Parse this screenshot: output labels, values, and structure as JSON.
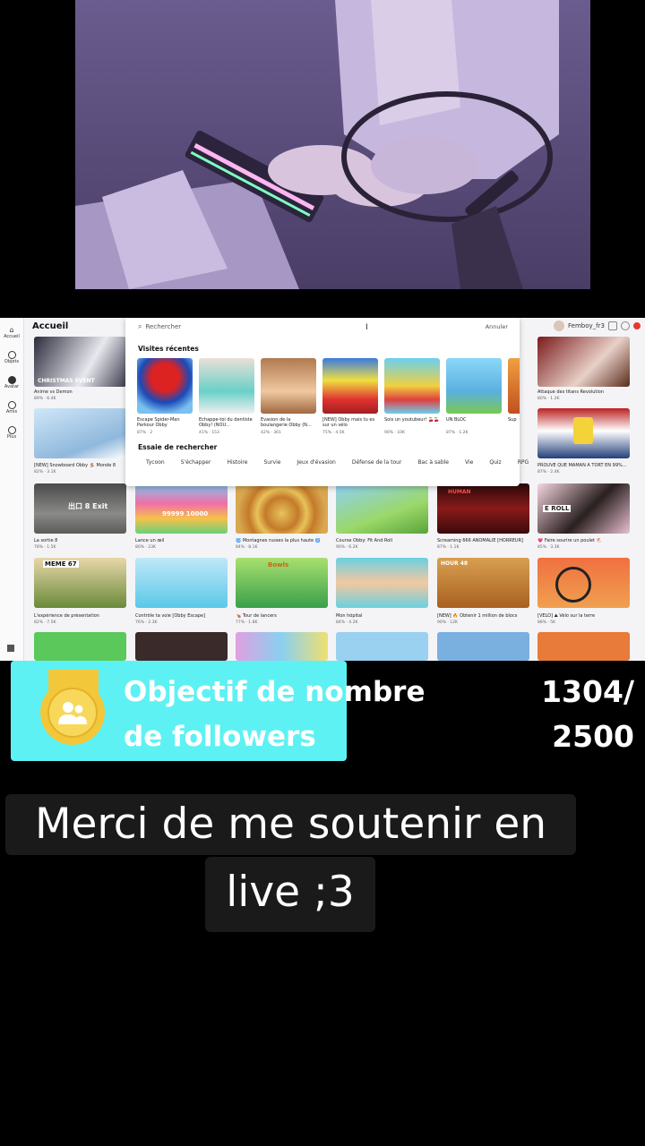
{
  "screen": {
    "title": "Accueil",
    "user_name": "Femboy_fr3",
    "sidebar": [
      {
        "label": "Accueil",
        "icon": "home-icon"
      },
      {
        "label": "Objets",
        "icon": "bag-icon"
      },
      {
        "label": "Avatar",
        "icon": "avatar-icon"
      },
      {
        "label": "Amis",
        "icon": "friends-icon"
      },
      {
        "label": "Plus",
        "icon": "more-icon"
      }
    ],
    "search": {
      "placeholder": "Rechercher",
      "cursor": "I",
      "cancel": "Annuler",
      "recent_title": "Visites récentes",
      "recent": [
        {
          "title": "Escape Spider-Man Parkour Obby",
          "rating": "87%",
          "players": "2"
        },
        {
          "title": "Echappe-toi du dentiste Obby! (NOU...",
          "rating": "41%",
          "players": "153"
        },
        {
          "title": "Évasion de la boulangerie Obby (N...",
          "rating": "42%",
          "players": "301"
        },
        {
          "title": "[NEW] Obby mais tu es sur un vélo",
          "rating": "75%",
          "players": "4.5K"
        },
        {
          "title": "Sois un youtubeur! 🍒🍒",
          "rating": "90%",
          "players": "10K"
        },
        {
          "title": "UN BLOC",
          "rating": "87%",
          "players": "1.2K"
        },
        {
          "title": "Sup",
          "rating": "",
          "players": ""
        }
      ],
      "suggest_title": "Essaie de rechercher",
      "chips": [
        "Tycoon",
        "S'échapper",
        "Histoire",
        "Survie",
        "Jeux d'évasion",
        "Défense de la tour",
        "Bac à sable",
        "Vie",
        "Quiz",
        "RPG"
      ]
    },
    "tiles": [
      {
        "title": "Anime vs Demon",
        "rating": "89% · 6.4K"
      },
      {
        "title": "Attaque des titans Revolution",
        "rating": "80% · 1.2K"
      },
      {
        "title": "[NEW] Snowboard Obby 🏂 Monde 8",
        "rating": "82% · 3.1K"
      },
      {
        "title": "PROUVE QUE MAMAN A TORT EN 99%...",
        "rating": "87% · 2.4K"
      },
      {
        "title": "La sortie 8",
        "rating": "78% · 1.5K"
      },
      {
        "title": "Lance un œil",
        "rating": "80% · 23K"
      },
      {
        "title": "🌀 Montagnes russes la plus haute 🌀",
        "rating": "84% · 8.1K"
      },
      {
        "title": "Course Obby: Fit And Roll",
        "rating": "90% · 6.2K"
      },
      {
        "title": "Screaming 666 ANOMALIE [HORREUR]",
        "rating": "87% · 1.1K"
      },
      {
        "title": "💗 Faire sourire un poulet 🐔",
        "rating": "85% · 3.3K"
      },
      {
        "title": "L'expérience de présentation",
        "rating": "82% · 7.5K"
      },
      {
        "title": "Contrôle ta voie [Obby Escape]",
        "rating": "76% · 2.3K"
      },
      {
        "title": "🍗 Tour de lancers",
        "rating": "77% · 1.8K"
      },
      {
        "title": "Mon hôpital",
        "rating": "84% · 4.2K"
      },
      {
        "title": "[NEW] 🔥 Obtenir 1 million de blocs",
        "rating": "90% · 12K"
      },
      {
        "title": "[VÉLO] ⛰ Vélo sur la terre",
        "rating": "88% · 5K"
      }
    ],
    "tile_labels": {
      "christmas": "CHRISTMAS EVENT",
      "exit": "出口 8 Exit",
      "rainbow": "99999 10000",
      "meme": "MEME 67",
      "bowl": "Bowls",
      "hour": "HOUR 48",
      "human": "HUMAN",
      "eroll": "E ROLL"
    }
  },
  "goal": {
    "title_line1": "Objectif de nombre",
    "title_line2": "de followers",
    "current": "1304/",
    "target": "2500",
    "icon": "followers-medal-icon"
  },
  "caption": {
    "line1": "Merci de me soutenir en",
    "line2": "live ;3"
  },
  "colors": {
    "goal_card": "#5ef1f4",
    "medal": "#f3c73a",
    "caption_bg": "#1a1a1a"
  }
}
